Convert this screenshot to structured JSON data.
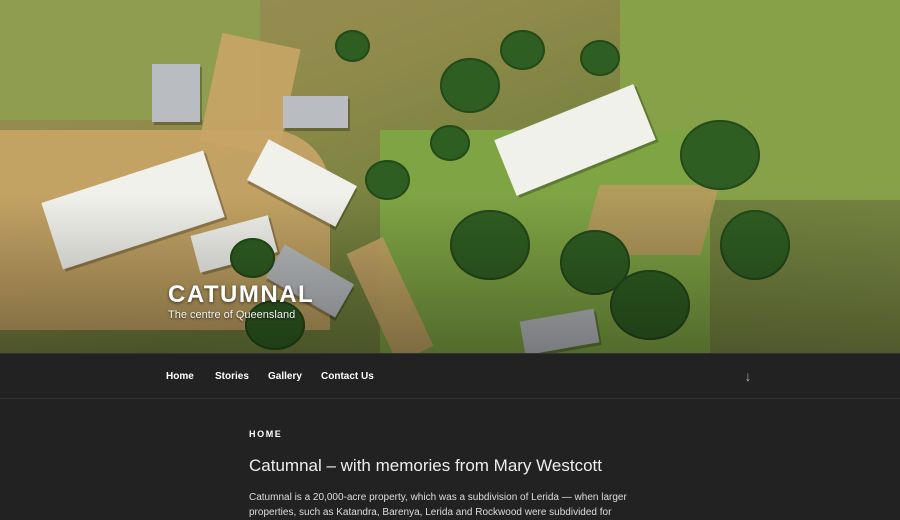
{
  "site": {
    "title": "CATUMNAL",
    "description": "The centre of Queensland"
  },
  "nav": {
    "items": [
      {
        "label": "Home"
      },
      {
        "label": "Stories"
      },
      {
        "label": "Gallery"
      },
      {
        "label": "Contact Us"
      }
    ],
    "scroll_icon": "arrow-down-icon"
  },
  "main": {
    "page_label": "HOME",
    "heading": "Catumnal – with memories from Mary Westcott",
    "paragraph": "Catumnal is a 20,000-acre property, which was a subdivision of Lerida — when larger properties, such as Katandra, Barenya, Lerida and Rockwood were subdivided for"
  },
  "colors": {
    "background": "#222222",
    "text": "#eeeeee"
  }
}
